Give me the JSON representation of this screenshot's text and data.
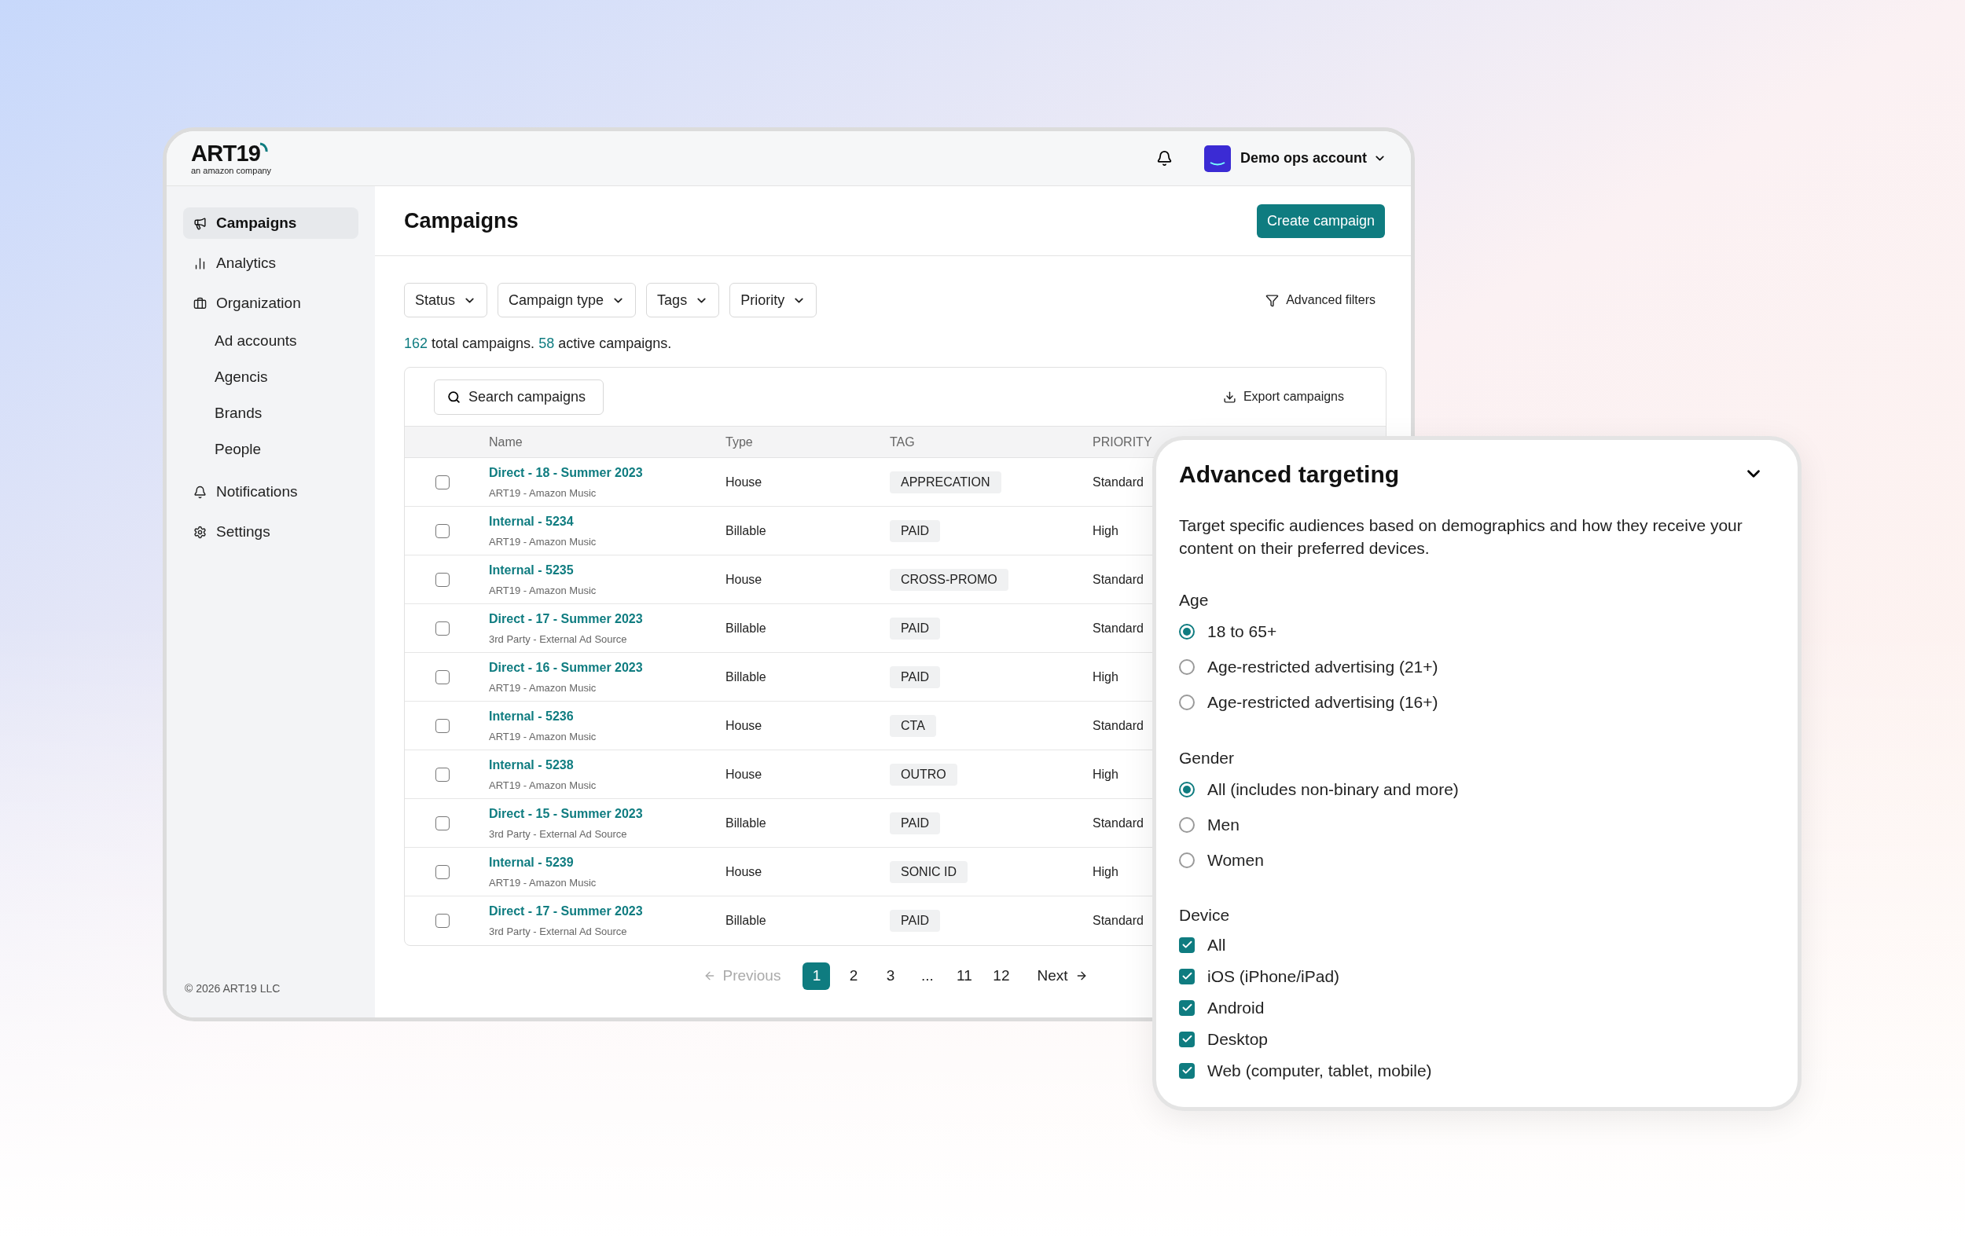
{
  "header": {
    "logo": {
      "wordmark": "ART19",
      "tagline": "an amazon company"
    },
    "account": "Demo ops account"
  },
  "sidebar": {
    "items": [
      {
        "label": "Campaigns",
        "selected": true
      },
      {
        "label": "Analytics",
        "selected": false
      },
      {
        "label": "Organization",
        "selected": false,
        "children": [
          {
            "label": "Ad accounts",
            "selected": false
          },
          {
            "label": "Agencis",
            "selected": false
          },
          {
            "label": "Brands",
            "selected": false
          },
          {
            "label": "People",
            "selected": false
          }
        ]
      },
      {
        "label": "Notifications",
        "selected": false
      },
      {
        "label": "Settings",
        "selected": false
      }
    ],
    "footer": "© 2026 ART19 LLC"
  },
  "page": {
    "title": "Campaigns",
    "create_button": "Create campaign"
  },
  "filters": [
    {
      "label": "Status"
    },
    {
      "label": "Campaign type"
    },
    {
      "label": "Tags"
    },
    {
      "label": "Priority"
    }
  ],
  "advanced_filters": "Advanced filters",
  "summary": [
    {
      "text": "162",
      "highlight": true
    },
    {
      "text": "total campaigns.",
      "highlight": false
    },
    {
      "text": "58",
      "highlight": true
    },
    {
      "text": "active campaigns.",
      "highlight": false
    }
  ],
  "search": {
    "placeholder": "Search campaigns"
  },
  "export": "Export campaigns",
  "table": {
    "columns": [
      "Name",
      "Type",
      "TAG",
      "PRIORITY"
    ],
    "rows": [
      {
        "checked": false,
        "name": "Direct - 18 - Summer 2023",
        "source": "ART19 - Amazon Music",
        "type": "House",
        "tag": "APPRECATION",
        "priority": "Standard"
      },
      {
        "checked": false,
        "name": "Internal - 5234",
        "source": "ART19 - Amazon Music",
        "type": "Billable",
        "tag": "PAID",
        "priority": "High"
      },
      {
        "checked": false,
        "name": "Internal - 5235",
        "source": "ART19 - Amazon Music",
        "type": "House",
        "tag": "CROSS-PROMO",
        "priority": "Standard"
      },
      {
        "checked": false,
        "name": "Direct - 17 - Summer 2023",
        "source": "3rd Party - External Ad Source",
        "type": "Billable",
        "tag": "PAID",
        "priority": "Standard"
      },
      {
        "checked": false,
        "name": "Direct - 16 - Summer 2023",
        "source": "ART19 - Amazon Music",
        "type": "Billable",
        "tag": "PAID",
        "priority": "High"
      },
      {
        "checked": false,
        "name": "Internal - 5236",
        "source": "ART19 - Amazon Music",
        "type": "House",
        "tag": "CTA",
        "priority": "Standard"
      },
      {
        "checked": false,
        "name": "Internal - 5238",
        "source": "ART19 - Amazon Music",
        "type": "House",
        "tag": "OUTRO",
        "priority": "High"
      },
      {
        "checked": false,
        "name": "Direct - 15 - Summer 2023",
        "source": "3rd Party - External Ad Source",
        "type": "Billable",
        "tag": "PAID",
        "priority": "Standard"
      },
      {
        "checked": false,
        "name": "Internal - 5239",
        "source": "ART19 - Amazon Music",
        "type": "House",
        "tag": "SONIC ID",
        "priority": "High"
      },
      {
        "checked": false,
        "name": "Direct - 17 - Summer 2023",
        "source": "3rd Party - External Ad Source",
        "type": "Billable",
        "tag": "PAID",
        "priority": "Standard"
      }
    ]
  },
  "pagination": {
    "previous": "Previous",
    "previous_disabled": true,
    "pages": [
      {
        "label": "1",
        "selected": true
      },
      {
        "label": "2",
        "selected": false
      },
      {
        "label": "3",
        "selected": false
      },
      {
        "label": "...",
        "selected": false
      },
      {
        "label": "11",
        "selected": false
      },
      {
        "label": "12",
        "selected": false
      }
    ],
    "next": "Next"
  },
  "panel": {
    "title": "Advanced targeting",
    "description": "Target specific audiences based on demographics and how they receive your content on their preferred devices.",
    "groups": [
      {
        "label": "Age",
        "kind": "radio",
        "options": [
          {
            "label": "18 to 65+",
            "selected": true
          },
          {
            "label": "Age-restricted advertising (21+)",
            "selected": false
          },
          {
            "label": "Age-restricted advertising (16+)",
            "selected": false
          }
        ]
      },
      {
        "label": "Gender",
        "kind": "radio",
        "options": [
          {
            "label": "All (includes non-binary and more)",
            "selected": true
          },
          {
            "label": "Men",
            "selected": false
          },
          {
            "label": "Women",
            "selected": false
          }
        ]
      },
      {
        "label": "Device",
        "kind": "checkbox",
        "options": [
          {
            "label": "All",
            "checked": true
          },
          {
            "label": "iOS (iPhone/iPad)",
            "checked": true
          },
          {
            "label": "Android",
            "checked": true
          },
          {
            "label": "Desktop",
            "checked": true
          },
          {
            "label": "Web (computer, tablet, mobile)",
            "checked": true
          }
        ]
      }
    ]
  }
}
